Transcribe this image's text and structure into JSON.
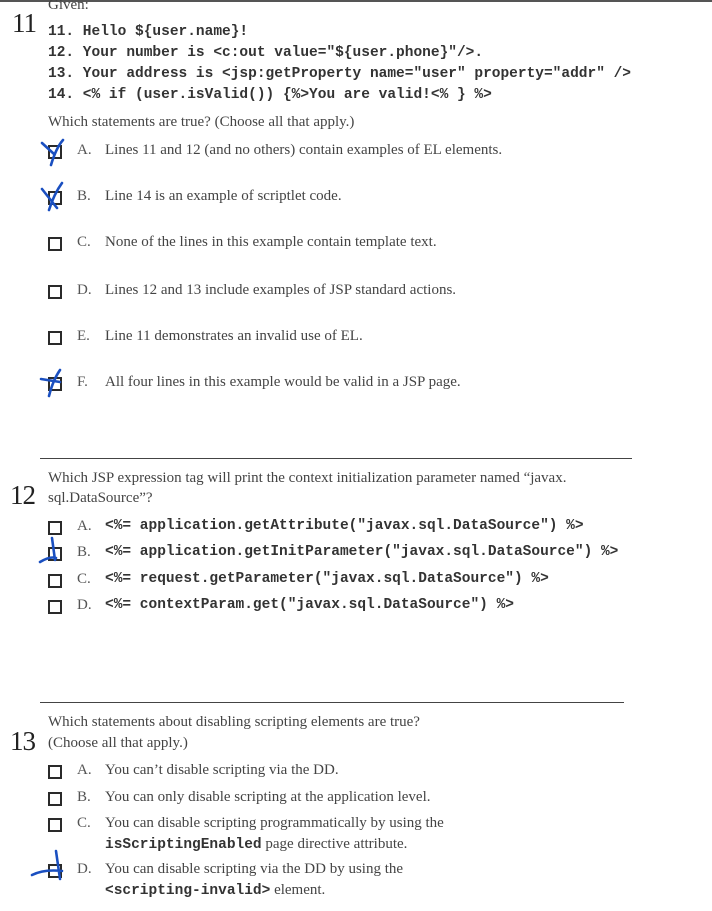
{
  "q11": {
    "number": "11",
    "given": "Given:",
    "code_lines": [
      "11. Hello ${user.name}!",
      "12. Your number is <c:out value=\"${user.phone}\"/>.",
      "13. Your address is <jsp:getProperty name=\"user\" property=\"addr\" />",
      "14. <% if (user.isValid()) {%>You are valid!<% } %>"
    ],
    "question": "Which statements are true? (Choose all that apply.)",
    "options": [
      {
        "letter": "A.",
        "text": "Lines 11 and 12 (and no others) contain examples of EL elements.",
        "checked": true
      },
      {
        "letter": "B.",
        "text": "Line 14 is an example of scriptlet code.",
        "checked": true
      },
      {
        "letter": "C.",
        "text": "None of the lines in this example contain template text.",
        "checked": false
      },
      {
        "letter": "D.",
        "text": "Lines 12 and 13 include examples of JSP standard actions.",
        "checked": false
      },
      {
        "letter": "E.",
        "text": "Line 11 demonstrates an invalid use of EL.",
        "checked": false
      },
      {
        "letter": "F.",
        "text": "All four lines in this example would be valid in a JSP page.",
        "checked": true
      }
    ]
  },
  "q12": {
    "number": "12",
    "question_line1": "Which JSP expression tag will print the context initialization parameter named “javax.",
    "question_line2": "sql.DataSource”?",
    "options": [
      {
        "letter": "A.",
        "code": "<%= application.getAttribute(\"javax.sql.DataSource\") %>",
        "checked": false
      },
      {
        "letter": "B.",
        "code": "<%= application.getInitParameter(\"javax.sql.DataSource\") %>",
        "checked": true
      },
      {
        "letter": "C.",
        "code": "<%= request.getParameter(\"javax.sql.DataSource\") %>",
        "checked": false
      },
      {
        "letter": "D.",
        "code": "<%= contextParam.get(\"javax.sql.DataSource\") %>",
        "checked": false
      }
    ]
  },
  "q13": {
    "number": "13",
    "question_line1": "Which statements about disabling scripting elements are true?",
    "question_line2": "(Choose all that apply.)",
    "options": [
      {
        "letter": "A.",
        "text": "You can’t disable scripting via the DD.",
        "checked": false
      },
      {
        "letter": "B.",
        "text": "You can only disable scripting at the application level.",
        "checked": false
      },
      {
        "letter": "C.",
        "text": "You can disable scripting programmatically by using the",
        "code": "isScriptingEnabled",
        "text2": " page directive attribute.",
        "checked": false
      },
      {
        "letter": "D.",
        "text": "You can disable scripting via the DD by using the",
        "code": "<scripting-invalid>",
        "text2": " element.",
        "checked": true
      }
    ]
  },
  "colors": {
    "pen_mark": "#1a4fc0",
    "text": "#444444",
    "box": "#2a2a2a"
  }
}
